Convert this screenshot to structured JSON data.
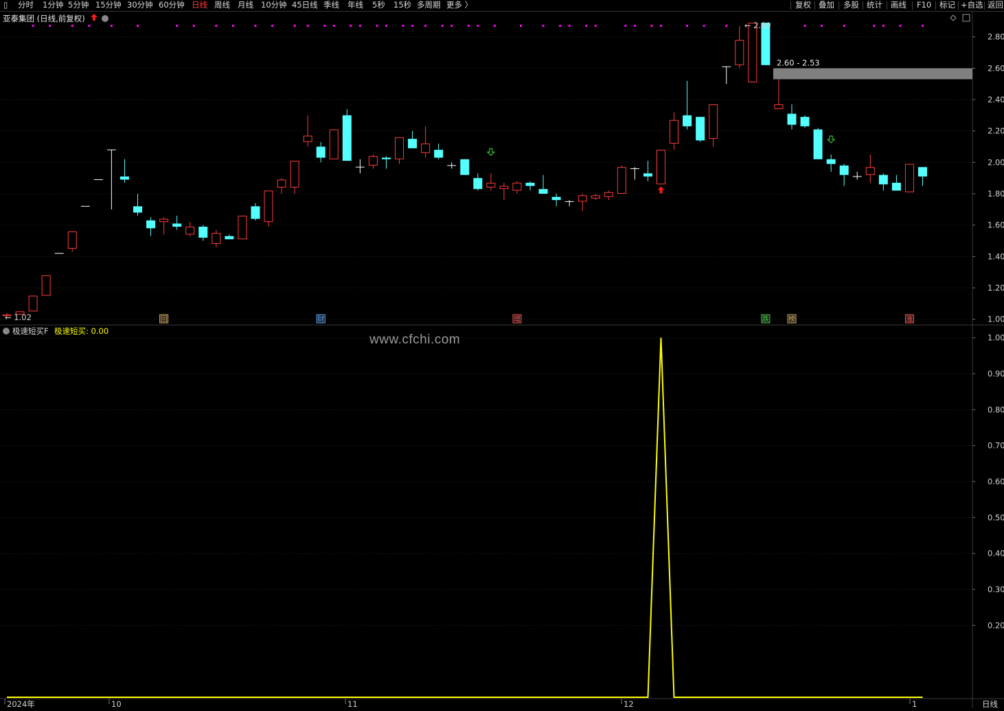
{
  "toolbar": {
    "left_items": [
      "分时",
      "1分钟",
      "5分钟",
      "15分钟",
      "30分钟",
      "60分钟",
      "日线",
      "周线",
      "月线",
      "10分钟",
      "45日线",
      "季线",
      "年线",
      "5秒",
      "15秒",
      "多周期",
      "更多 〉"
    ],
    "active": "日线",
    "right_items": [
      "复权",
      "叠加",
      "多股",
      "统计",
      "画线",
      "F10",
      "标记",
      "+自选",
      "返回"
    ]
  },
  "main_panel": {
    "title": "亚泰集团 (日线,前复权)",
    "high_label": "2.89",
    "low_label": "1.02",
    "range_label": "2.60 - 2.53",
    "price_ticks": [
      "2.80",
      "2.60",
      "2.40",
      "2.20",
      "2.00",
      "1.80",
      "1.60",
      "1.40",
      "1.20",
      "1.00"
    ],
    "event_badges": [
      {
        "text": "回",
        "color": "#e0b060"
      },
      {
        "text": "财",
        "color": "#60a8ff"
      },
      {
        "text": "增",
        "color": "#ff5050"
      },
      {
        "text": "跌",
        "color": "#40d040"
      },
      {
        "text": "榜",
        "color": "#e0b060"
      },
      {
        "text": "涨",
        "color": "#ff5050"
      }
    ]
  },
  "indicator_panel": {
    "name": "极速短买F",
    "value_label": "极速短买: 0.00",
    "ticks": [
      "1.00",
      "0.90",
      "0.80",
      "0.70",
      "0.60",
      "0.50",
      "0.40",
      "0.30",
      "0.20"
    ]
  },
  "x_axis": {
    "labels": [
      "2024年",
      "10",
      "11",
      "12",
      "1"
    ],
    "period_label": "日线"
  },
  "watermark": "www.cfchi.com",
  "colors": {
    "up": "#ff3b3b",
    "down": "#54ffff",
    "flat": "#ffffff",
    "indicator_line": "#ffff00",
    "signal_dots": "#ff00ff",
    "range_band": "#808080"
  },
  "chart_data": {
    "type": "candlestick",
    "series": [
      {
        "name": "price",
        "ohlc": [
          [
            1.02,
            1.04,
            1.02,
            1.03
          ],
          [
            1.03,
            1.05,
            1.03,
            1.05
          ],
          [
            1.05,
            1.15,
            1.05,
            1.15
          ],
          [
            1.15,
            1.28,
            1.15,
            1.28
          ],
          [
            1.42,
            1.42,
            1.42,
            1.42
          ],
          [
            1.45,
            1.56,
            1.43,
            1.56
          ],
          [
            1.72,
            1.72,
            1.72,
            1.72
          ],
          [
            1.89,
            1.89,
            1.89,
            1.89
          ],
          [
            2.08,
            2.08,
            1.7,
            2.08
          ],
          [
            1.91,
            2.02,
            1.87,
            1.89
          ],
          [
            1.72,
            1.8,
            1.66,
            1.68
          ],
          [
            1.63,
            1.65,
            1.53,
            1.58
          ],
          [
            1.62,
            1.65,
            1.54,
            1.64
          ],
          [
            1.61,
            1.66,
            1.57,
            1.59
          ],
          [
            1.54,
            1.62,
            1.53,
            1.59
          ],
          [
            1.59,
            1.6,
            1.5,
            1.52
          ],
          [
            1.48,
            1.57,
            1.46,
            1.55
          ],
          [
            1.53,
            1.54,
            1.51,
            1.51
          ],
          [
            1.51,
            1.66,
            1.51,
            1.66
          ],
          [
            1.72,
            1.74,
            1.63,
            1.64
          ],
          [
            1.62,
            1.82,
            1.59,
            1.82
          ],
          [
            1.84,
            1.9,
            1.8,
            1.89
          ],
          [
            1.84,
            2.01,
            1.8,
            2.01
          ],
          [
            2.13,
            2.3,
            2.1,
            2.17
          ],
          [
            2.1,
            2.13,
            2.0,
            2.03
          ],
          [
            2.02,
            2.21,
            2.02,
            2.21
          ],
          [
            2.3,
            2.34,
            2.01,
            2.01
          ],
          [
            1.97,
            2.02,
            1.93,
            1.97
          ],
          [
            1.98,
            2.05,
            1.96,
            2.04
          ],
          [
            2.03,
            2.04,
            1.96,
            2.02
          ],
          [
            2.02,
            2.14,
            1.99,
            2.16
          ],
          [
            2.15,
            2.2,
            2.09,
            2.09
          ],
          [
            2.06,
            2.23,
            2.03,
            2.12
          ],
          [
            2.08,
            2.12,
            2.02,
            2.03
          ],
          [
            1.98,
            2.0,
            1.96,
            1.98
          ],
          [
            2.02,
            2.02,
            1.92,
            1.92
          ],
          [
            1.9,
            1.93,
            1.82,
            1.83
          ],
          [
            1.84,
            1.93,
            1.82,
            1.87
          ],
          [
            1.83,
            1.87,
            1.76,
            1.85
          ],
          [
            1.82,
            1.88,
            1.8,
            1.87
          ],
          [
            1.87,
            1.88,
            1.82,
            1.85
          ],
          [
            1.83,
            1.92,
            1.8,
            1.8
          ],
          [
            1.78,
            1.8,
            1.72,
            1.76
          ],
          [
            1.75,
            1.76,
            1.72,
            1.75
          ],
          [
            1.75,
            1.8,
            1.69,
            1.79
          ],
          [
            1.77,
            1.8,
            1.76,
            1.79
          ],
          [
            1.78,
            1.82,
            1.76,
            1.81
          ],
          [
            1.8,
            1.98,
            1.8,
            1.97
          ],
          [
            1.96,
            1.97,
            1.89,
            1.96
          ],
          [
            1.93,
            2.01,
            1.88,
            1.91
          ],
          [
            1.86,
            2.08,
            1.86,
            2.08
          ],
          [
            2.12,
            2.32,
            2.08,
            2.27
          ],
          [
            2.3,
            2.52,
            2.21,
            2.23
          ],
          [
            2.29,
            2.29,
            2.13,
            2.14
          ],
          [
            2.15,
            2.37,
            2.1,
            2.37
          ],
          [
            2.61,
            2.61,
            2.5,
            2.61
          ],
          [
            2.62,
            2.87,
            2.6,
            2.78
          ],
          [
            2.51,
            2.89,
            2.51,
            2.89
          ],
          [
            2.89,
            2.89,
            2.62,
            2.62
          ],
          [
            2.34,
            2.53,
            2.34,
            2.37
          ],
          [
            2.31,
            2.37,
            2.21,
            2.24
          ],
          [
            2.29,
            2.3,
            2.22,
            2.23
          ],
          [
            2.21,
            2.22,
            2.02,
            2.02
          ],
          [
            2.02,
            2.05,
            1.94,
            1.99
          ],
          [
            1.98,
            1.99,
            1.85,
            1.92
          ],
          [
            1.91,
            1.94,
            1.89,
            1.91
          ],
          [
            1.92,
            2.05,
            1.87,
            1.97
          ],
          [
            1.92,
            1.93,
            1.82,
            1.86
          ],
          [
            1.87,
            1.92,
            1.82,
            1.82
          ],
          [
            1.81,
            1.99,
            1.81,
            1.99
          ],
          [
            1.97,
            1.97,
            1.85,
            1.91
          ]
        ]
      }
    ],
    "indicator": {
      "name": "极速短买",
      "peak_index": 50,
      "peak_value": 1.0,
      "baseline": 0.0
    },
    "ylim_price": [
      0.99,
      2.93
    ],
    "ylim_indicator": [
      0.0,
      1.03
    ]
  }
}
